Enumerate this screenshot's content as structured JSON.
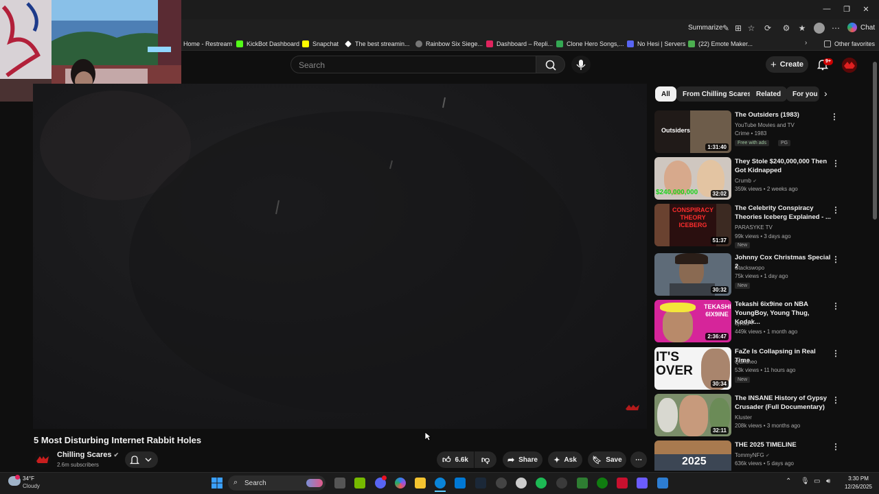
{
  "browser": {
    "toolbar": {
      "summarize_label": "Summarize",
      "chat_label": "Chat"
    },
    "bookmarks": [
      {
        "label": "Home - Restream",
        "color": "#2b2b2b"
      },
      {
        "label": "KickBot Dashboard",
        "color": "#53fc18"
      },
      {
        "label": "Snapchat",
        "color": "#fffc00"
      },
      {
        "label": "The best streamin...",
        "color": "#ffffff"
      },
      {
        "label": "Rainbow Six Siege...",
        "color": "#777777"
      },
      {
        "label": "Dashboard – Repli...",
        "color": "#e0245e"
      },
      {
        "label": "Clone Hero Songs,...",
        "color": "#34a853"
      },
      {
        "label": "No Hesi | Servers",
        "color": "#5865f2"
      },
      {
        "label": "(22) Emote Maker...",
        "color": "#4caf50"
      }
    ],
    "other_favorites": "Other favorites"
  },
  "youtube": {
    "search_placeholder": "Search",
    "create_label": "Create",
    "notification_badge": "9+",
    "video": {
      "title": "5 Most Disturbing Internet Rabbit Holes",
      "channel": "Chilling Scares",
      "subscribers": "2.6m subscribers",
      "likes": "6.6k",
      "share_label": "Share",
      "ask_label": "Ask",
      "save_label": "Save"
    },
    "chips": [
      "All",
      "From Chilling Scares",
      "Related",
      "For you"
    ],
    "recommendations": [
      {
        "title": "The Outsiders (1983)",
        "channel": "YouTube Movies and TV",
        "meta": "Crime • 1983",
        "badge1": "Free with ads",
        "badge2": "PG",
        "duration": "1:31:40",
        "thumb_color": "#6d5c4a",
        "thumb_text": "Outsiders"
      },
      {
        "title": "They Stole $240,000,000 Then Got Kidnapped",
        "channel": "Crumb",
        "meta": "359k views • 2 weeks ago",
        "duration": "32:02",
        "thumb_color": "#cfc7c0",
        "thumb_text": "$240,000,000"
      },
      {
        "title": "The Celebrity Conspiracy Theories Iceberg Explained - ...",
        "channel": "PARASYKE TV",
        "meta": "99k views • 3 days ago",
        "badge1": "New",
        "duration": "51:37",
        "thumb_color": "#4a1a1a",
        "thumb_text": "CONSPIRACY THEORY ICEBERG"
      },
      {
        "title": "Johnny Cox Christmas Special 2",
        "channel": "Stackswopo",
        "meta": "75k views • 1 day ago",
        "badge1": "New",
        "duration": "30:32",
        "thumb_color": "#5e6b78",
        "thumb_text": ""
      },
      {
        "title": "Tekashi 6ix9ine on NBA YoungBoy, Young Thug, Kodak...",
        "channel": "djvlad",
        "meta": "449k views • 1 month ago",
        "duration": "2:36:47",
        "thumb_color": "#d6259a",
        "thumb_text": "TEKASHI 6IX9INE"
      },
      {
        "title": "FaZe Is Collapsing in Real Time",
        "channel": "Quintheo",
        "meta": "53k views • 11 hours ago",
        "badge1": "New",
        "duration": "30:34",
        "thumb_color": "#f4f4f4",
        "thumb_text": "IT'S OVER"
      },
      {
        "title": "The INSANE History of Gypsy Crusader (Full Documentary)",
        "channel": "Kluster",
        "meta": "208k views • 3 months ago",
        "duration": "32:11",
        "thumb_color": "#7b8e6a",
        "thumb_text": ""
      },
      {
        "title": "THE 2025 TIMELINE",
        "channel": "TommyNFG",
        "meta": "636k views • 5 days ago",
        "duration": "",
        "thumb_color": "#3c4654",
        "thumb_text": "2025"
      }
    ]
  },
  "taskbar": {
    "weather_temp": "34°F",
    "weather_condition": "Cloudy",
    "search_label": "Search",
    "time": "3:30 PM",
    "date": "12/26/2025"
  }
}
